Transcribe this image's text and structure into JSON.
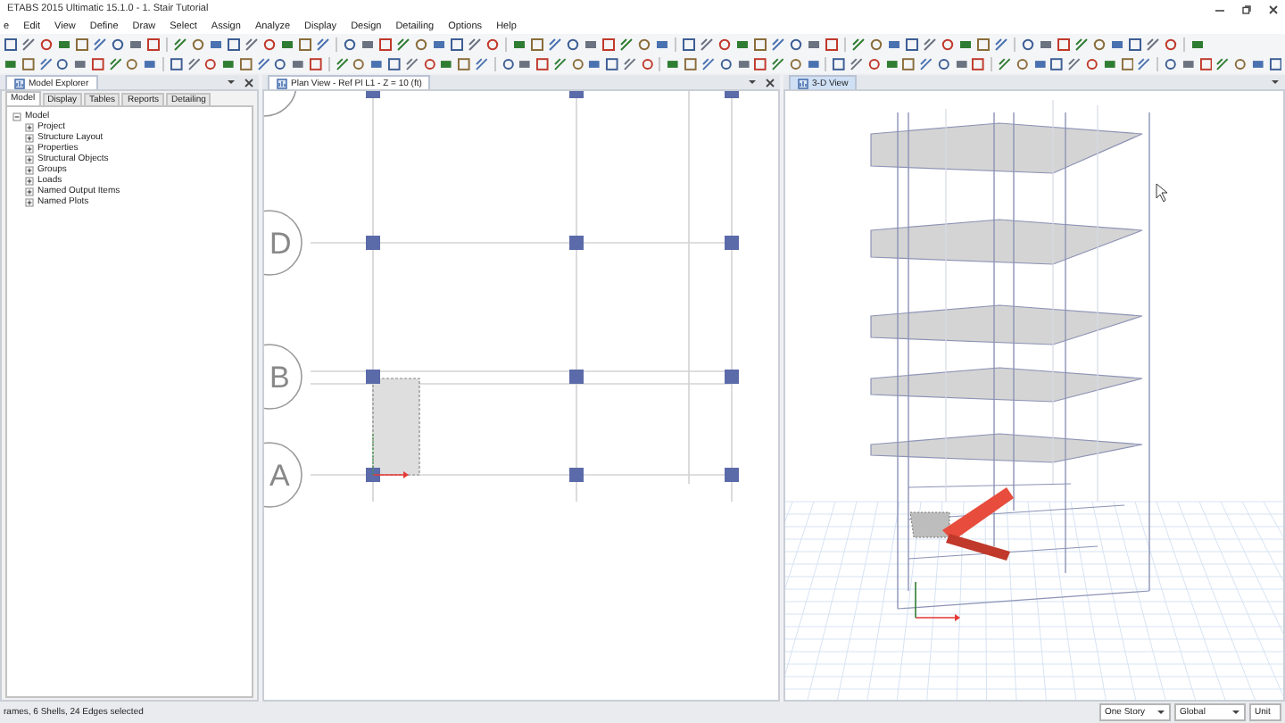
{
  "window": {
    "title": "ETABS 2015 Ultimatic 15.1.0 - 1. Stair Tutorial"
  },
  "menu": [
    "e",
    "Edit",
    "View",
    "Define",
    "Draw",
    "Select",
    "Assign",
    "Analyze",
    "Display",
    "Design",
    "Detailing",
    "Options",
    "Help"
  ],
  "left_panel": {
    "title": "Model Explorer",
    "tabs": [
      {
        "label": "Model",
        "selected": true
      },
      {
        "label": "Display",
        "selected": false
      },
      {
        "label": "Tables",
        "selected": false
      },
      {
        "label": "Reports",
        "selected": false
      },
      {
        "label": "Detailing",
        "selected": false
      }
    ],
    "tree": [
      {
        "label": "Model",
        "expanded": true,
        "children": [
          {
            "label": "Project",
            "expanded": false
          },
          {
            "label": "Structure Layout",
            "expanded": false
          },
          {
            "label": "Properties",
            "expanded": false
          },
          {
            "label": "Structural Objects",
            "expanded": false
          },
          {
            "label": "Groups",
            "expanded": false
          },
          {
            "label": "Loads",
            "expanded": false
          },
          {
            "label": "Named Output Items",
            "expanded": false
          },
          {
            "label": "Named Plots",
            "expanded": false
          }
        ]
      }
    ]
  },
  "plan_view": {
    "title": "Plan View - Ref Pl L1 - Z = 10 (ft)",
    "grid_labels": [
      "D",
      "B",
      "A"
    ]
  },
  "view_3d": {
    "title": "3-D View"
  },
  "status_bar": {
    "text": "rames, 6 Shells, 24 Edges selected",
    "dropdowns": [
      "One Story",
      "Global",
      "Unit"
    ]
  }
}
